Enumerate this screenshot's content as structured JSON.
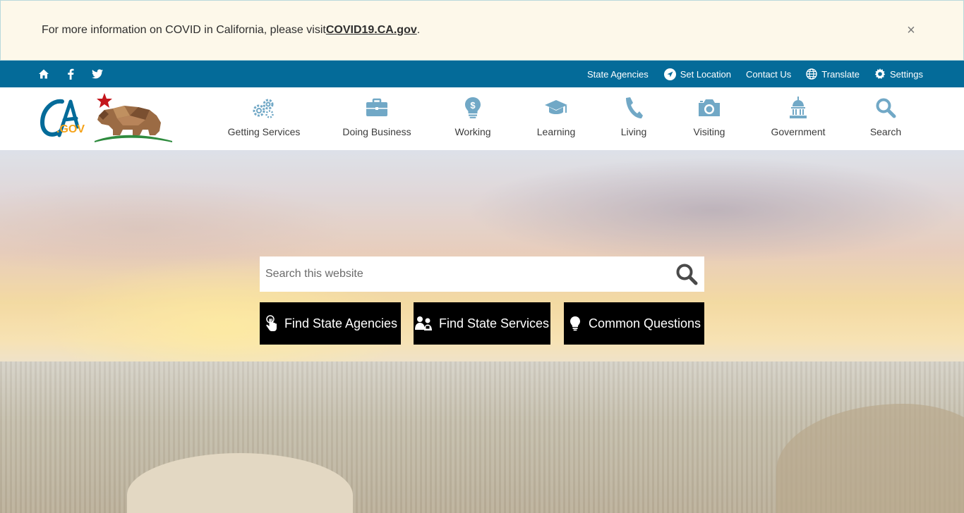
{
  "alert": {
    "text": "For more information on COVID in California, please visit ",
    "link": "COVID19.CA.gov",
    "suffix": ".",
    "close": "×"
  },
  "utility": {
    "social": [
      "home-icon",
      "facebook-icon",
      "twitter-icon"
    ],
    "links": [
      {
        "label": "State Agencies",
        "icon": ""
      },
      {
        "label": "Set Location",
        "icon": "location-icon"
      },
      {
        "label": "Contact Us",
        "icon": ""
      },
      {
        "label": "Translate",
        "icon": "globe-icon"
      },
      {
        "label": "Settings",
        "icon": "gear-icon"
      }
    ]
  },
  "nav": {
    "items": [
      {
        "label": "Getting Services",
        "icon": "gears-icon"
      },
      {
        "label": "Doing Business",
        "icon": "briefcase-icon"
      },
      {
        "label": "Working",
        "icon": "lightbulb-dollar-icon"
      },
      {
        "label": "Learning",
        "icon": "graduation-cap-icon"
      },
      {
        "label": "Living",
        "icon": "phone-handset-icon"
      },
      {
        "label": "Visiting",
        "icon": "camera-icon"
      },
      {
        "label": "Government",
        "icon": "capitol-icon"
      },
      {
        "label": "Search",
        "icon": "search-icon"
      }
    ]
  },
  "search": {
    "placeholder": "Search this website"
  },
  "quick": {
    "agencies": "Find State Agencies",
    "services": "Find State Services",
    "questions": "Common Questions"
  },
  "colors": {
    "utility_bar": "#046b99",
    "alert_bg": "#fdf8ea",
    "nav_icon": "#71a8c6",
    "ca_blue": "#046b99",
    "ca_gold": "#f5a31a",
    "bear_brown": "#8b5e3c",
    "star_red": "#c4161c",
    "grass_green": "#2e8b3e"
  }
}
